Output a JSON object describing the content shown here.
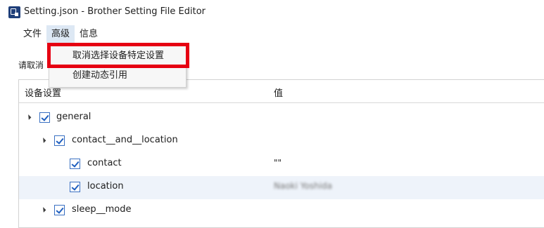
{
  "window": {
    "title": "Setting.json - Brother Setting File Editor",
    "icon": "app-icon"
  },
  "menubar": [
    {
      "label": "文件"
    },
    {
      "label": "高级"
    },
    {
      "label": "信息"
    }
  ],
  "dropdown": [
    {
      "label": "取消选择设备特定设置"
    },
    {
      "label": "创建动态引用"
    }
  ],
  "prompt": "请取消",
  "table": {
    "columns": [
      "设备设置",
      "值"
    ],
    "rows": [
      {
        "label": "general",
        "checked": true,
        "value": ""
      },
      {
        "label": "contact__and__location",
        "checked": true,
        "value": ""
      },
      {
        "label": "contact",
        "checked": true,
        "value": "\"\""
      },
      {
        "label": "location",
        "checked": true,
        "value": "Naoki Yoshida"
      },
      {
        "label": "sleep__mode",
        "checked": true,
        "value": ""
      }
    ]
  },
  "colors": {
    "highlight": "#e60012",
    "row_alt": "#eef3fa",
    "checkbox": "#3a70c2"
  }
}
